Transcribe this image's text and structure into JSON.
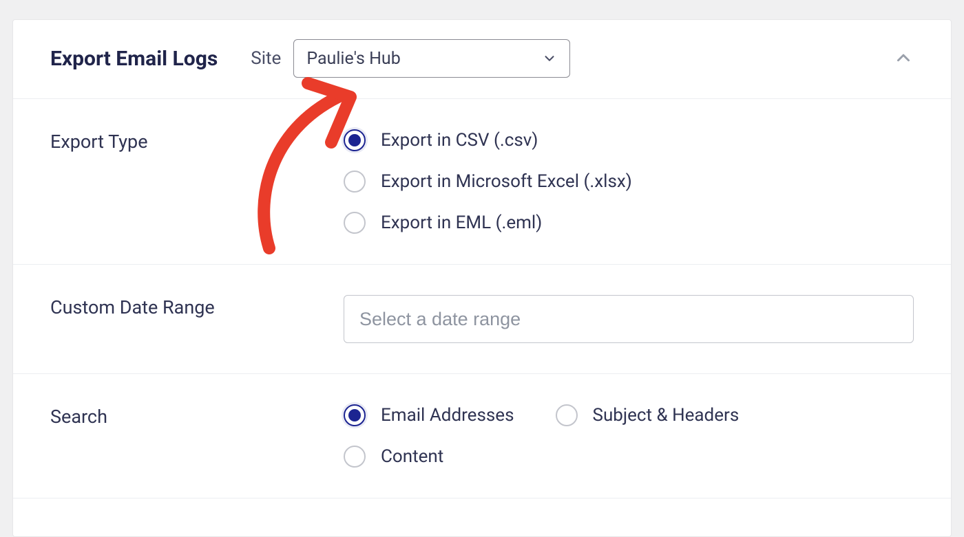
{
  "header": {
    "title": "Export Email Logs",
    "site_label": "Site",
    "site_selected": "Paulie's Hub"
  },
  "sections": {
    "export_type": {
      "label": "Export Type",
      "options": [
        {
          "label": "Export in CSV (.csv)",
          "selected": true
        },
        {
          "label": "Export in Microsoft Excel (.xlsx)",
          "selected": false
        },
        {
          "label": "Export in EML (.eml)",
          "selected": false
        }
      ]
    },
    "date_range": {
      "label": "Custom Date Range",
      "placeholder": "Select a date range",
      "value": ""
    },
    "search": {
      "label": "Search",
      "options": [
        {
          "label": "Email Addresses",
          "selected": true
        },
        {
          "label": "Subject & Headers",
          "selected": false
        },
        {
          "label": "Content",
          "selected": false
        }
      ]
    }
  },
  "colors": {
    "accent": "#1c2491",
    "annotation": "#e93c2a"
  }
}
